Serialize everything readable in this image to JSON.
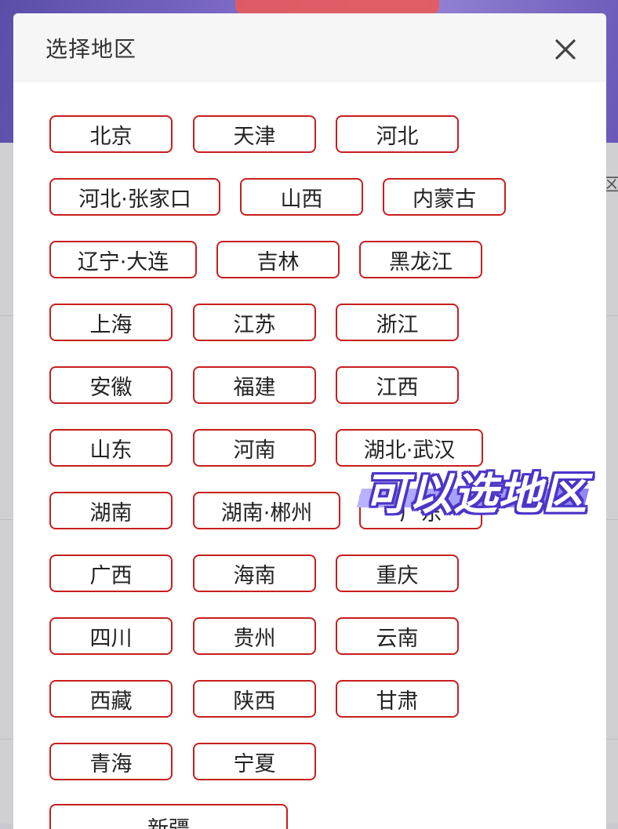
{
  "modal": {
    "title": "选择地区",
    "close_icon": "close-icon"
  },
  "regions": [
    [
      "北京",
      "天津",
      "河北"
    ],
    [
      "河北·张家口",
      "山西",
      "内蒙古"
    ],
    [
      "辽宁·大连",
      "吉林",
      "黑龙江"
    ],
    [
      "上海",
      "江苏",
      "浙江"
    ],
    [
      "安徽",
      "福建",
      "江西"
    ],
    [
      "山东",
      "河南",
      "湖北·武汉"
    ],
    [
      "湖南",
      "湖南·郴州",
      "广东"
    ],
    [
      "广西",
      "海南",
      "重庆"
    ],
    [
      "四川",
      "贵州",
      "云南"
    ],
    [
      "西藏",
      "陕西",
      "甘肃"
    ],
    [
      "青海",
      "宁夏"
    ],
    [
      "新疆"
    ]
  ],
  "overlay": {
    "caption": "可以选地区"
  },
  "background": {
    "edge_char": "区"
  },
  "colors": {
    "chip_border": "#c81e1e",
    "overlay_outline": "#4a35c8",
    "overlay_stripe": "#9a92f7"
  }
}
